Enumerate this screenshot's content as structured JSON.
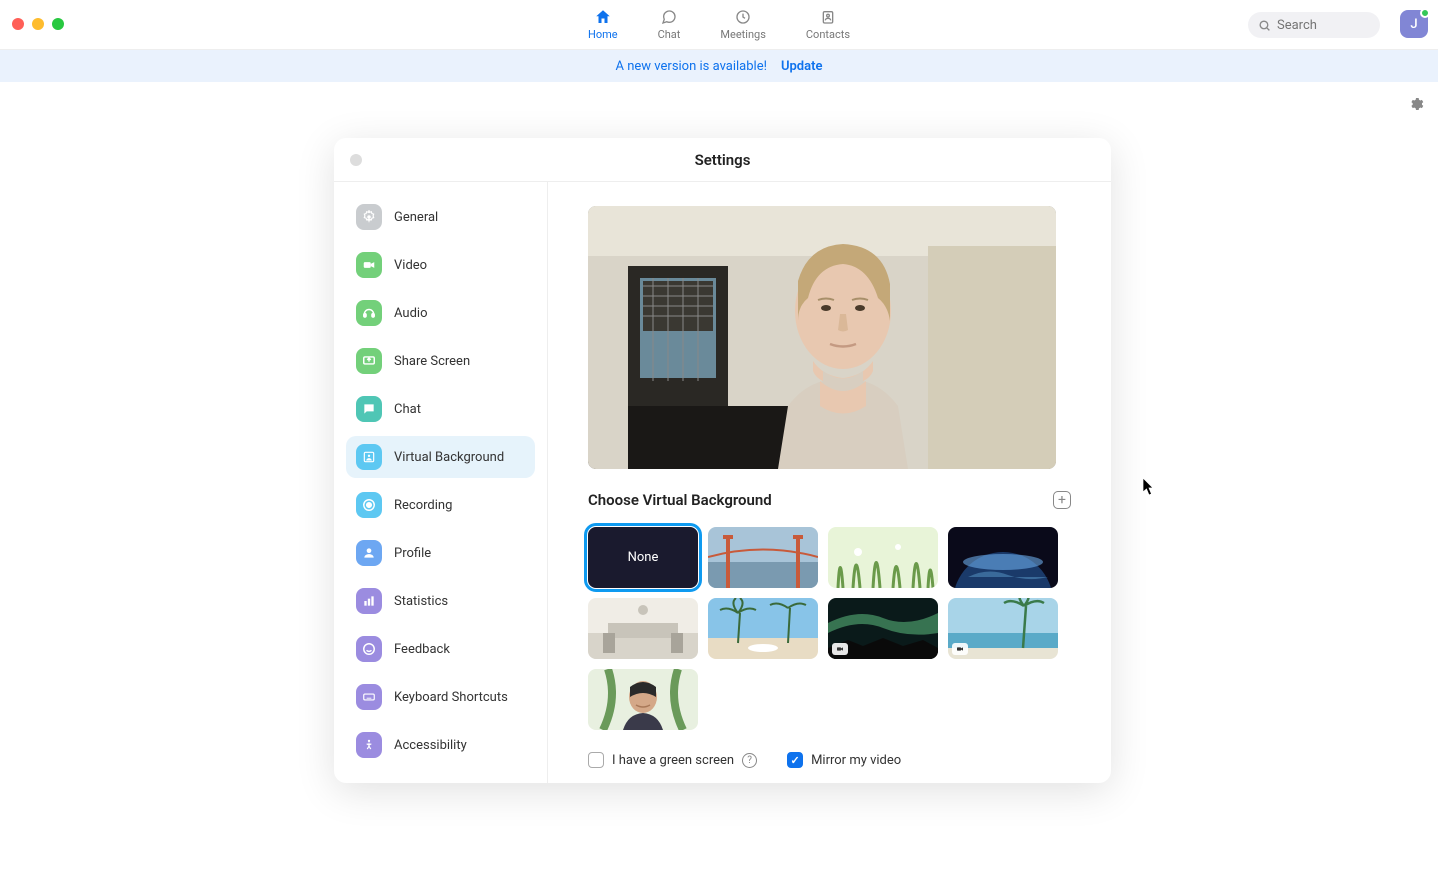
{
  "nav": {
    "items": [
      {
        "label": "Home",
        "active": true
      },
      {
        "label": "Chat",
        "active": false
      },
      {
        "label": "Meetings",
        "active": false
      },
      {
        "label": "Contacts",
        "active": false
      }
    ]
  },
  "search": {
    "placeholder": "Search"
  },
  "avatar": {
    "initial": "J"
  },
  "banner": {
    "text": "A new version is available!",
    "action": "Update"
  },
  "settings": {
    "title": "Settings",
    "sidebar": {
      "items": [
        {
          "label": "General",
          "icon": "gear",
          "color": "#c9cccf"
        },
        {
          "label": "Video",
          "icon": "video",
          "color": "#73d07a"
        },
        {
          "label": "Audio",
          "icon": "audio",
          "color": "#73d07a"
        },
        {
          "label": "Share Screen",
          "icon": "share",
          "color": "#73d07a"
        },
        {
          "label": "Chat",
          "icon": "chat",
          "color": "#4fc6b5"
        },
        {
          "label": "Virtual Background",
          "icon": "vb",
          "color": "#5dc8f2",
          "active": true
        },
        {
          "label": "Recording",
          "icon": "record",
          "color": "#5dc8f2"
        },
        {
          "label": "Profile",
          "icon": "profile",
          "color": "#6da7f2"
        },
        {
          "label": "Statistics",
          "icon": "stats",
          "color": "#9b8ce0"
        },
        {
          "label": "Feedback",
          "icon": "feedback",
          "color": "#9b8ce0"
        },
        {
          "label": "Keyboard Shortcuts",
          "icon": "keyboard",
          "color": "#9b8ce0"
        },
        {
          "label": "Accessibility",
          "icon": "accessibility",
          "color": "#9b8ce0"
        }
      ]
    },
    "main": {
      "section_title": "Choose Virtual Background",
      "backgrounds": [
        {
          "id": "none",
          "label": "None",
          "selected": true
        },
        {
          "id": "golden-gate",
          "video": false
        },
        {
          "id": "grass",
          "video": false
        },
        {
          "id": "earth",
          "video": false
        },
        {
          "id": "meeting-room",
          "video": false
        },
        {
          "id": "palm-beach-1",
          "video": false
        },
        {
          "id": "aurora",
          "video": true
        },
        {
          "id": "palm-beach-2",
          "video": true
        },
        {
          "id": "person",
          "video": false
        }
      ],
      "green_screen_label": "I have a green screen",
      "green_screen_checked": false,
      "mirror_label": "Mirror my video",
      "mirror_checked": true
    }
  }
}
